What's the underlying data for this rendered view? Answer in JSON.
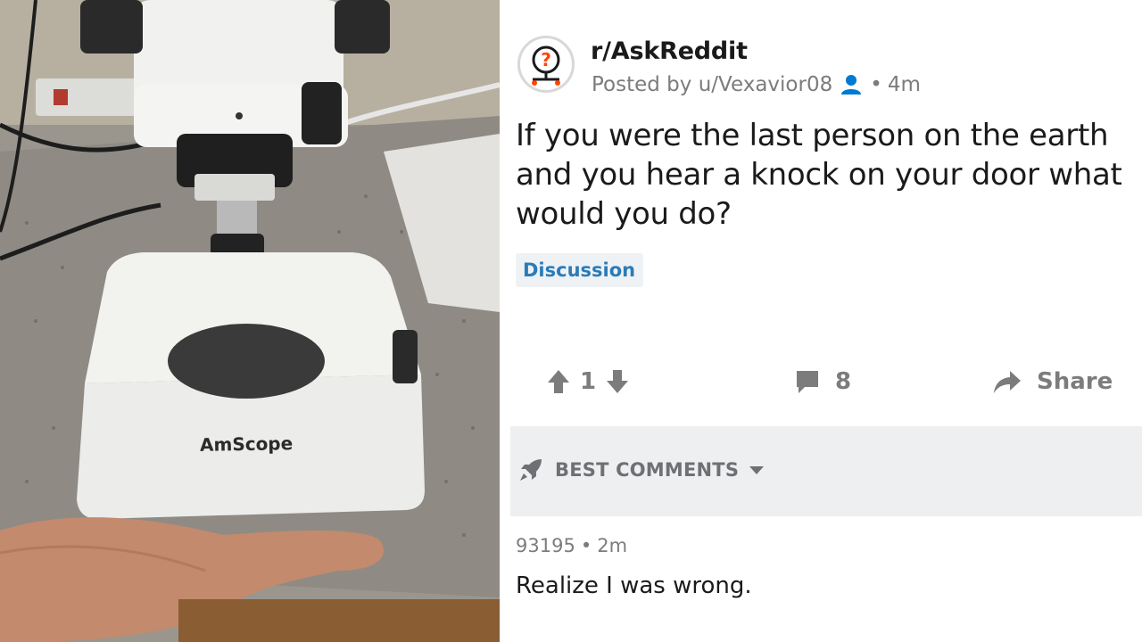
{
  "photo": {
    "brand_label": "AmScope"
  },
  "post": {
    "subreddit": "r/AskReddit",
    "posted_by": "Posted by u/Vexavior08",
    "separator": "•",
    "time_ago": "4m",
    "title": "If you were the last person on the earth and you hear a knock on your door what would you do?",
    "flair": "Discussion"
  },
  "actions": {
    "upvotes": "1",
    "comments": "8",
    "share_label": "Share"
  },
  "comments_section": {
    "sort_label": "BEST COMMENTS",
    "comment": {
      "author": "93195",
      "separator": "•",
      "time_ago": "2m",
      "body": "Realize I was wrong."
    }
  },
  "colors": {
    "flair_text": "#2b7bb9",
    "flair_bg": "#eef2f5",
    "user_icon": "#0079d3",
    "action_gray": "#7c7c7c",
    "sort_bar_bg": "#edeff1"
  }
}
